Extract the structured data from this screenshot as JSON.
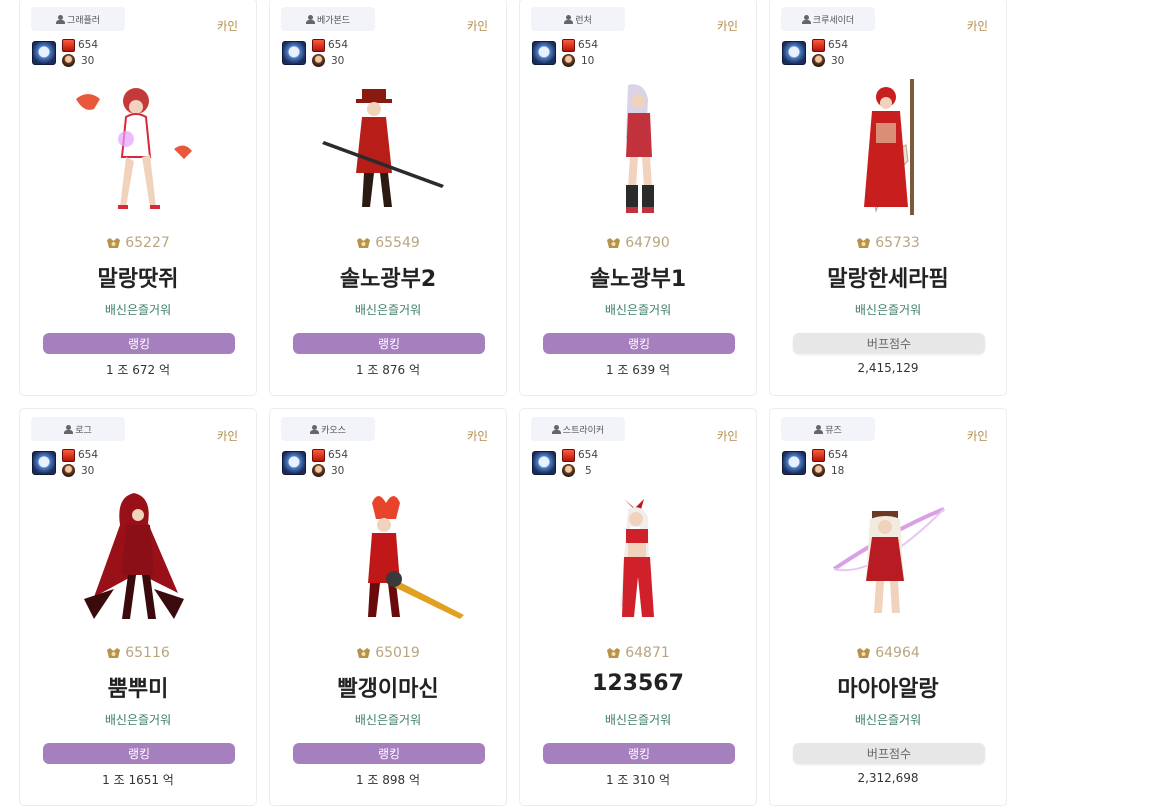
{
  "cards": [
    {
      "job": "그래플러",
      "server": "카인",
      "fame": "654",
      "level": "30",
      "score": "65227",
      "name": "말랑땃쥐",
      "guild": "배신은즐거워",
      "stat_label": "랭킹",
      "stat_value": "1 조 672 억",
      "colors": {
        "hair": "#c43a3a",
        "outfit": "#ffffff",
        "accent": "#d8283c"
      }
    },
    {
      "job": "베가본드",
      "server": "카인",
      "fame": "654",
      "level": "30",
      "score": "65549",
      "name": "솔노광부2",
      "guild": "배신은즐거워",
      "stat_label": "랭킹",
      "stat_value": "1 조 876 억",
      "colors": {
        "hair": "#8a1a10",
        "outfit": "#b81e18",
        "accent": "#2b1a12"
      }
    },
    {
      "job": "런처",
      "server": "카인",
      "fame": "654",
      "level": "10",
      "score": "64790",
      "name": "솔노광부1",
      "guild": "배신은즐거워",
      "stat_label": "랭킹",
      "stat_value": "1 조 639 억",
      "colors": {
        "hair": "#d9d2e8",
        "outfit": "#c2323c",
        "accent": "#2b2b2b"
      }
    },
    {
      "job": "크루세이더",
      "server": "카인",
      "fame": "654",
      "level": "30",
      "score": "65733",
      "name": "말랑한세라핌",
      "guild": "배신은즐거워",
      "stat_label": "버프점수",
      "stat_value": "2,415,129",
      "colors": {
        "hair": "#e8d8b0",
        "outfit": "#c81e1e",
        "accent": "#d9c9a8"
      }
    },
    {
      "job": "로그",
      "server": "카인",
      "fame": "654",
      "level": "30",
      "score": "65116",
      "name": "뿜뿌미",
      "guild": "배신은즐거워",
      "stat_label": "랭킹",
      "stat_value": "1 조 1651 억",
      "colors": {
        "hair": "#9a1018",
        "outfit": "#8b0f16",
        "accent": "#3a0a0c"
      }
    },
    {
      "job": "카오스",
      "server": "카인",
      "fame": "654",
      "level": "30",
      "score": "65019",
      "name": "빨갱이마신",
      "guild": "배신은즐거워",
      "stat_label": "랭킹",
      "stat_value": "1 조 898 억",
      "colors": {
        "hair": "#e8442c",
        "outfit": "#c01818",
        "accent": "#e0a020"
      }
    },
    {
      "job": "스트라이커",
      "server": "카인",
      "fame": "654",
      "level": "5",
      "score": "64871",
      "name": "123567",
      "guild": "배신은즐거워",
      "stat_label": "랭킹",
      "stat_value": "1 조 310 억",
      "colors": {
        "hair": "#eeeeee",
        "outfit": "#d0202a",
        "accent": "#c01818"
      }
    },
    {
      "job": "뮤즈",
      "server": "카인",
      "fame": "654",
      "level": "18",
      "score": "64964",
      "name": "마아아알랑",
      "guild": "배신은즐거워",
      "stat_label": "버프점수",
      "stat_value": "2,312,698",
      "colors": {
        "hair": "#f2ece0",
        "outfit": "#b81c22",
        "accent": "#d9a0e8"
      }
    }
  ]
}
